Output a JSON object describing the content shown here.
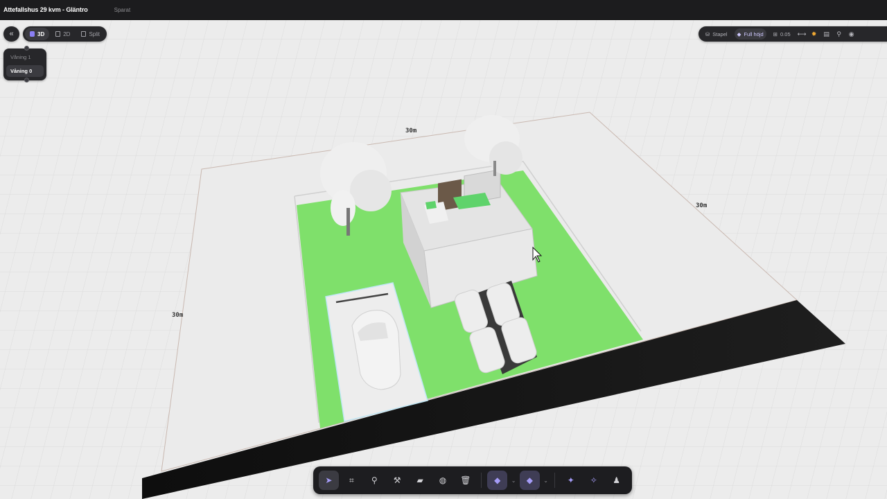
{
  "header": {
    "title": "Attefallshus 29 kvm - Gläntro",
    "save_status": "Sparat"
  },
  "view_modes": {
    "back_icon": "double-chevron-left-icon",
    "items": [
      {
        "label": "3D",
        "active": true
      },
      {
        "label": "2D",
        "active": false
      },
      {
        "label": "Split",
        "active": false
      }
    ]
  },
  "floors": {
    "items": [
      {
        "label": "Våning 1",
        "active": false
      },
      {
        "label": "Våning 0",
        "active": true
      }
    ]
  },
  "right_toolbar": {
    "stack_label": "Stapel",
    "height_label": "Full höjd",
    "grid_value": "0.05",
    "icons": [
      "ruler-icon",
      "sun-icon",
      "building-icon",
      "signpost-icon",
      "eye-icon"
    ],
    "accent": "#8b7ff5",
    "sun_color": "#f0a933"
  },
  "dimensions": {
    "top": "30m",
    "right": "30m",
    "left": "30m"
  },
  "bottom_toolbar": {
    "tools": [
      {
        "name": "select-tool",
        "icon": "cursor-icon",
        "active": true
      },
      {
        "name": "crop-tool",
        "icon": "crop-icon"
      },
      {
        "name": "pin-tool",
        "icon": "map-pin-icon"
      },
      {
        "name": "hammer-tool",
        "icon": "hammer-icon"
      },
      {
        "name": "material-tool",
        "icon": "brick-icon"
      },
      {
        "name": "texture-tool",
        "icon": "globe-icon"
      },
      {
        "name": "delete-tool",
        "icon": "trash-icon"
      },
      {
        "name": "layer-tool-a",
        "icon": "layers-icon",
        "active": true
      },
      {
        "name": "layer-tool-b",
        "icon": "layers-icon",
        "active": true
      },
      {
        "name": "orbit-tool",
        "icon": "orbit-icon"
      },
      {
        "name": "walk-tool",
        "icon": "walk-icon"
      },
      {
        "name": "person-tool",
        "icon": "person-icon"
      }
    ]
  },
  "scene_colors": {
    "lawn": "#7ee06a",
    "road": "#141414",
    "ground": "#ececec",
    "grid": "#d6d6d6"
  }
}
